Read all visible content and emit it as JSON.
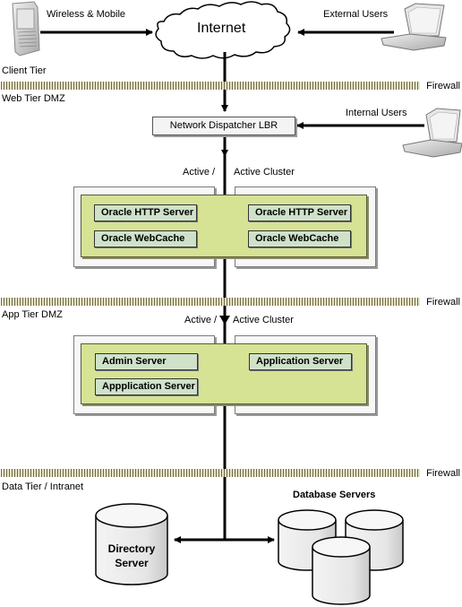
{
  "client_tier": {
    "label": "Client Tier",
    "wireless_label": "Wireless & Mobile",
    "external_label": "External Users",
    "internet_label": "Internet"
  },
  "web_tier": {
    "label": "Web Tier DMZ",
    "firewall_label": "Firewall",
    "lbr_label": "Network Dispatcher LBR",
    "internal_label": "Internal Users",
    "cluster_left": "Active /",
    "cluster_right": "Active Cluster",
    "left_components": [
      "Oracle HTTP Server",
      "Oracle WebCache"
    ],
    "right_components": [
      "Oracle HTTP Server",
      "Oracle WebCache"
    ]
  },
  "app_tier": {
    "label": "App Tier DMZ",
    "firewall_label": "Firewall",
    "cluster_left": "Active /",
    "cluster_right": "Active Cluster",
    "left_components": [
      "Admin Server",
      "Appplication Server"
    ],
    "right_components": [
      "Application Server"
    ]
  },
  "data_tier": {
    "label": "Data Tier / Intranet",
    "firewall_label": "Firewall",
    "directory_line1": "Directory",
    "directory_line2": "Server",
    "database_label": "Database Servers"
  },
  "colors": {
    "cluster_green": "#d6e294",
    "component_green": "#cfe2c9",
    "firewall_stripe": "#6e6a48"
  }
}
